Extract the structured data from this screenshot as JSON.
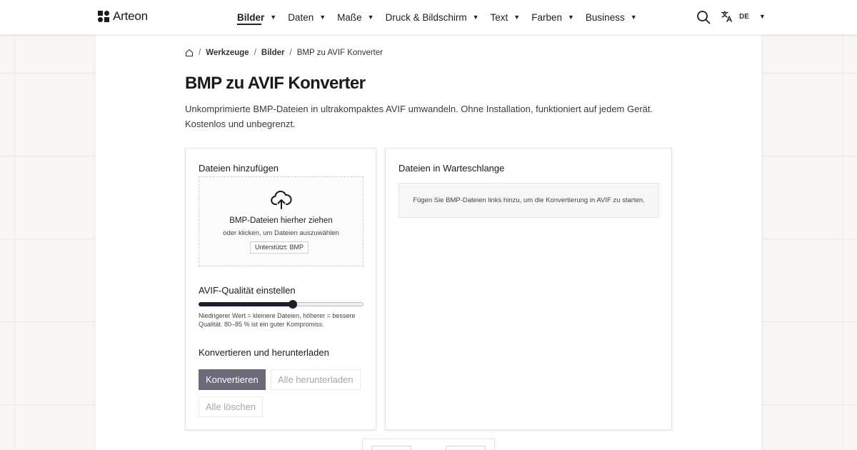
{
  "header": {
    "logo_text": "Arteon",
    "nav": [
      {
        "label": "Bilder",
        "active": true
      },
      {
        "label": "Daten",
        "active": false
      },
      {
        "label": "Maße",
        "active": false
      },
      {
        "label": "Druck & Bildschirm",
        "active": false
      },
      {
        "label": "Text",
        "active": false
      },
      {
        "label": "Farben",
        "active": false
      },
      {
        "label": "Business",
        "active": false
      }
    ],
    "search_icon": "search-icon",
    "language": {
      "icon": "translate-icon",
      "code": "DE"
    }
  },
  "breadcrumb": {
    "home_icon": "home-icon",
    "items": [
      "Werkzeuge",
      "Bilder"
    ],
    "current": "BMP zu AVIF Konverter"
  },
  "page": {
    "title": "BMP zu AVIF Konverter",
    "description": "Unkomprimierte BMP-Dateien in ultrakompaktes AVIF umwandeln. Ohne Installation, funktioniert auf jedem Gerät. Kostenlos und unbegrenzt."
  },
  "left_panel": {
    "add_files_title": "Dateien hinzufügen",
    "dropzone": {
      "icon": "cloud-upload-icon",
      "title": "BMP-Dateien hierher ziehen",
      "subtitle": "oder klicken, um Dateien auszuwählen",
      "badge": "Unterstützt: BMP"
    },
    "quality_title": "AVIF-Qualität einstellen",
    "quality_fraction": 0.57,
    "quality_hint": "Niedrigerer Wert = kleinere Dateien, höherer = bessere Qualität. 80–85 % ist ein guter Kompromiss.",
    "convert_title": "Konvertieren und herunterladen",
    "buttons": {
      "convert": "Konvertieren",
      "download_all": "Alle herunterladen",
      "clear_all": "Alle löschen"
    }
  },
  "right_panel": {
    "title": "Dateien in Warteschlange",
    "empty_message": "Fügen Sie BMP-Dateien links hinzu, um die Konvertierung in AVIF zu starten."
  },
  "colors": {
    "primary_button": "#6b6a78",
    "slider_fill": "#1e1e2e",
    "page_background": "#f7f6f4"
  }
}
